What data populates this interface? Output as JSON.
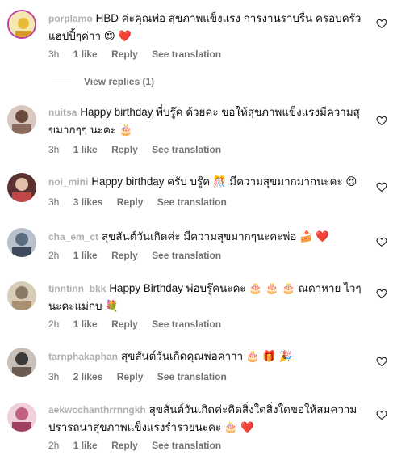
{
  "comments": [
    {
      "username": "porplamo",
      "text": "HBD ค่ะคุณพ่อ สุขภาพแข็งแรง การงานราบรื่น ครอบครัวแฮปปี้ๆค่าา 😍 ❤️",
      "time": "3h",
      "likes": "1 like",
      "reply": "Reply",
      "translate": "See translation",
      "avatar_color": "#e8b838"
    },
    {
      "username": "nuitsa",
      "text": "Happy birthday พี่บรู๊ค ด้วยคะ ขอให้สุขภาพแข็งแรงมีความสุขมากๆๆ นะคะ 🎂",
      "time": "3h",
      "likes": "1 like",
      "reply": "Reply",
      "translate": "See translation",
      "avatar_color": "#6b4a3a"
    },
    {
      "username": "noi_mini",
      "text": "Happy birthday ครับ บรู๊ค 🎊 มีความสุขมากมากนะคะ 😍",
      "time": "3h",
      "likes": "3 likes",
      "reply": "Reply",
      "translate": "See translation",
      "avatar_color": "#7a3b3b"
    },
    {
      "username": "cha_em_ct",
      "text": "สุขสันต์วันเกิดค่ะ มีความสุขมากๆนะคะพ่อ 🍰 ❤️",
      "time": "2h",
      "likes": "1 like",
      "reply": "Reply",
      "translate": "See translation",
      "avatar_color": "#5d6b80"
    },
    {
      "username": "tinntinn_bkk",
      "text": "Happy Birthday พ่อบรู๊คนะคะ 🎂 🎂 🎂 ณดาหาย ไวๆนะคะแม่กบ 💐",
      "time": "2h",
      "likes": "1 like",
      "reply": "Reply",
      "translate": "See translation",
      "avatar_color": "#8a7a64"
    },
    {
      "username": "tarnphakaphan",
      "text": "สุขสันต์วันเกิดคุณพ่อค่าาา 🎂 🎁 🎉",
      "time": "3h",
      "likes": "2 likes",
      "reply": "Reply",
      "translate": "See translation",
      "avatar_color": "#3a3a3a"
    },
    {
      "username": "aekwcchanthrrnngkh",
      "text": "สุขสันต์วันเกิดค่ะคิดสิ่งใดสิ่งใดขอให้สมความปรารถนาสุขภาพแข็งแรงร่ำรวยนะคะ 🎂 ❤️",
      "time": "2h",
      "likes": "1 like",
      "reply": "Reply",
      "translate": "See translation",
      "avatar_color": "#c06080"
    }
  ],
  "view_replies": "View replies (1)",
  "icons": {
    "heart": "heart-outline-icon"
  }
}
